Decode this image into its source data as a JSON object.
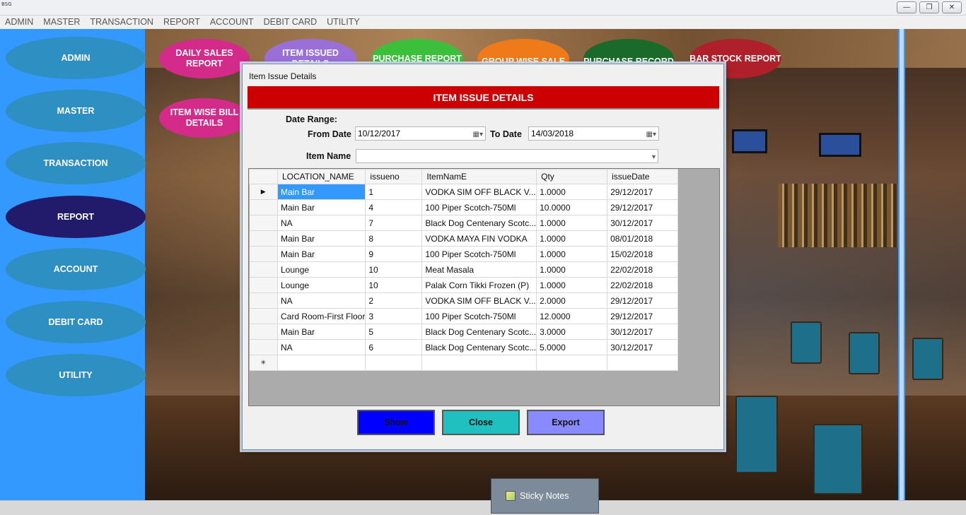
{
  "window": {
    "app_icon_text": "BSG",
    "buttons": [
      "—",
      "❐",
      "✕"
    ]
  },
  "menubar": [
    "ADMIN",
    "MASTER",
    "TRANSACTION",
    "REPORT",
    "ACCOUNT",
    "DEBIT CARD",
    "UTILITY"
  ],
  "sidebar": {
    "items": [
      {
        "label": "ADMIN",
        "active": false
      },
      {
        "label": "MASTER",
        "active": false
      },
      {
        "label": "TRANSACTION",
        "active": false
      },
      {
        "label": "REPORT",
        "active": true
      },
      {
        "label": "ACCOUNT",
        "active": false
      },
      {
        "label": "DEBIT CARD",
        "active": false
      },
      {
        "label": "UTILITY",
        "active": false
      }
    ],
    "color": "#3399ff",
    "oval_color": "#2e8fc2",
    "active_color": "#221a6b"
  },
  "reports": [
    {
      "label": "DAILY SALES REPORT",
      "color": "#d42a8a"
    },
    {
      "label": "ITEM ISSUED DETAILS",
      "color": "#9b6fd8"
    },
    {
      "label": "PURCHASE REPORT",
      "color": "#3cc03c"
    },
    {
      "label": "GROUP WISE SALE REPORT",
      "color": "#ee7a1a"
    },
    {
      "label": "PURCHASE RECORD LEVEL REPORT",
      "color": "#1a6b2a"
    },
    {
      "label": "BAR STOCK REPORT",
      "color": "#b0202a"
    },
    {
      "label": "ITEM WISE BILL DETAILS",
      "color": "#d42a8a"
    }
  ],
  "dialog": {
    "title": "Item Issue Details",
    "header": "ITEM ISSUE DETAILS",
    "header_color": "#cc0000",
    "date_range_label": "Date Range:",
    "from_label": "From Date",
    "from_value": "10/12/2017",
    "to_label": "To Date",
    "to_value": "14/03/2018",
    "item_name_label": "Item Name",
    "item_name_value": "",
    "columns": [
      "LOCATION_NAME",
      "issueno",
      "ItemNamE",
      "Qty",
      "issueDate"
    ],
    "rows": [
      [
        "Main Bar",
        "1",
        "VODKA SIM OFF BLACK V...",
        "1.0000",
        "29/12/2017"
      ],
      [
        "Main Bar",
        "4",
        "100 Piper Scotch-750Ml",
        "10.0000",
        "29/12/2017"
      ],
      [
        "NA",
        "7",
        "Black Dog Centenary Scotc...",
        "1.0000",
        "30/12/2017"
      ],
      [
        "Main Bar",
        "8",
        "VODKA MAYA FIN VODKA",
        "1.0000",
        "08/01/2018"
      ],
      [
        "Main Bar",
        "9",
        "100 Piper Scotch-750Ml",
        "1.0000",
        "15/02/2018"
      ],
      [
        "Lounge",
        "10",
        "Meat Masala",
        "1.0000",
        "22/02/2018"
      ],
      [
        "Lounge",
        "10",
        "Palak Corn Tikki Frozen (P)",
        "1.0000",
        "22/02/2018"
      ],
      [
        "NA",
        "2",
        "VODKA SIM OFF BLACK V...",
        "2.0000",
        "29/12/2017"
      ],
      [
        "Card Room-First Floor",
        "3",
        "100 Piper Scotch-750Ml",
        "12.0000",
        "29/12/2017"
      ],
      [
        "Main Bar",
        "5",
        "Black Dog Centenary Scotc...",
        "3.0000",
        "30/12/2017"
      ],
      [
        "NA",
        "6",
        "Black Dog Centenary Scotc...",
        "5.0000",
        "30/12/2017"
      ]
    ],
    "current_row_marker": "▶",
    "new_row_marker": "✳",
    "buttons": {
      "show": {
        "label": "Show",
        "color": "#0000ff"
      },
      "close": {
        "label": "Close",
        "color": "#20c0c0"
      },
      "export": {
        "label": "Export",
        "color": "#8a8aff"
      }
    }
  },
  "taskbar": {
    "sticky_notes_label": "Sticky Notes",
    "icon": "sticky-notes-icon"
  }
}
